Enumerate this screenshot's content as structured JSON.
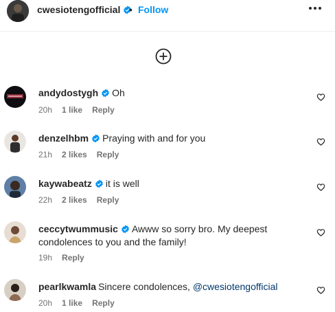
{
  "header": {
    "username": "cwesiotengofficial",
    "separator": "•",
    "follow_label": "Follow"
  },
  "comments": [
    {
      "username": "andydostygh",
      "verified": true,
      "text": "Oh",
      "mention": "",
      "time": "20h",
      "likes": "1 like",
      "reply": "Reply"
    },
    {
      "username": "denzelhbm",
      "verified": true,
      "text": "Praying with and for you",
      "mention": "",
      "time": "21h",
      "likes": "2 likes",
      "reply": "Reply"
    },
    {
      "username": "kaywabeatz",
      "verified": true,
      "text": "it is well",
      "mention": "",
      "time": "22h",
      "likes": "2 likes",
      "reply": "Reply"
    },
    {
      "username": "ceccytwummusic",
      "verified": true,
      "text": "Awww so sorry bro. My deepest condolences to you and the family!",
      "mention": "",
      "time": "19h",
      "likes": "",
      "reply": "Reply"
    },
    {
      "username": "pearlkwamla",
      "verified": false,
      "text": "Sincere condolences, ",
      "mention": "@cwesiotengofficial",
      "time": "20h",
      "likes": "1 like",
      "reply": "Reply"
    }
  ],
  "colors": {
    "accent": "#0095f6",
    "verified": "#0095f6",
    "mention": "#00376b",
    "meta": "#737373"
  },
  "icons": [
    "verified-badge-icon",
    "more-options-icon",
    "load-more-comments-icon",
    "heart-icon"
  ]
}
